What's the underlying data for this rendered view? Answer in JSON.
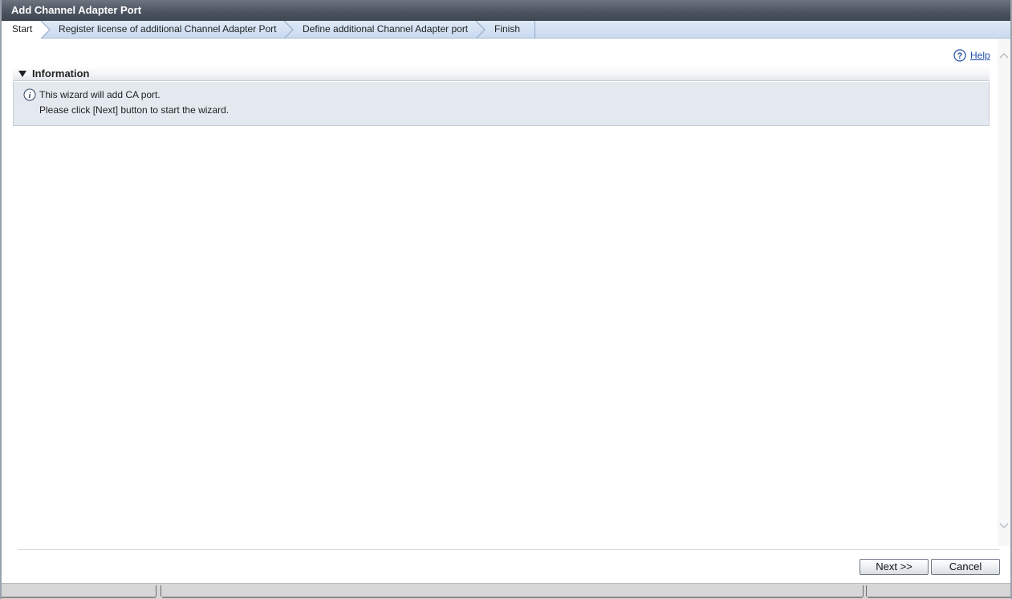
{
  "window": {
    "title": "Add Channel Adapter Port"
  },
  "wizard_steps": [
    {
      "label": "Start",
      "active": true
    },
    {
      "label": "Register license of additional Channel Adapter Port",
      "active": false
    },
    {
      "label": "Define additional Channel Adapter port",
      "active": false
    },
    {
      "label": "Finish",
      "active": false
    }
  ],
  "help": {
    "label": "Help",
    "icon": "help-circle-icon"
  },
  "information": {
    "title": "Information",
    "toggle_icon": "triangle-down-icon",
    "icon": "info-circle-icon",
    "line1": "This wizard will add CA port.",
    "line2": "Please click [Next] button to start the wizard."
  },
  "footer": {
    "next_label": "Next >>",
    "cancel_label": "Cancel"
  },
  "colors": {
    "titlebar": "#4d5561",
    "steps_bar": "#c9daf0",
    "info_background": "#e4e9f0",
    "link": "#1f4fa8"
  }
}
